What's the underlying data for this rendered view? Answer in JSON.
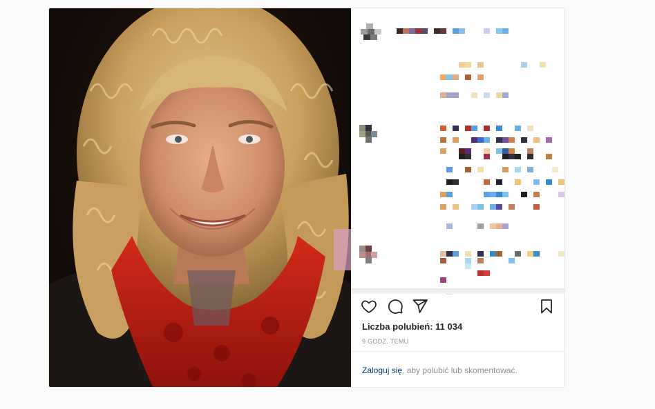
{
  "post": {
    "likes_label": "Liczba polubień: 11 034",
    "time_label": "9 GODZ. TEMU",
    "login_link": "Zaloguj się",
    "login_rest": ", aby polubić lub skomentować."
  },
  "icons": {
    "like": "heart-icon",
    "comment": "comment-icon",
    "share": "paper-plane-icon",
    "save": "bookmark-icon"
  },
  "colors": {
    "link": "#00376b",
    "muted": "#8e8e8e",
    "text": "#262626"
  }
}
